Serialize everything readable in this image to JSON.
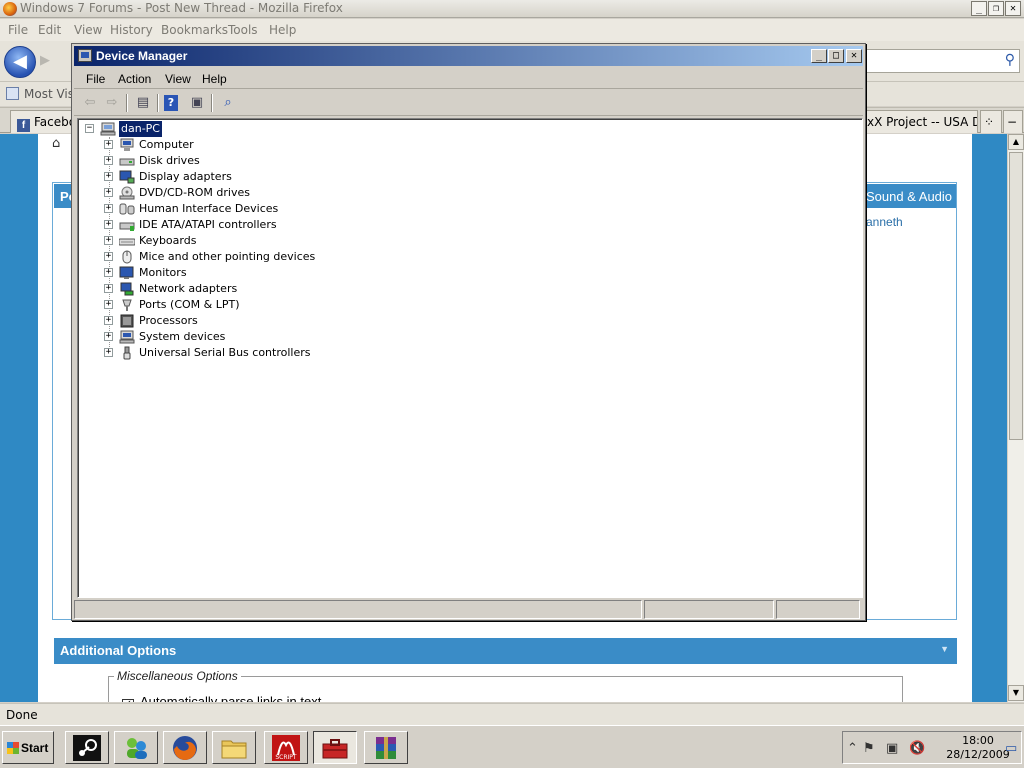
{
  "firefox": {
    "title": "Windows 7 Forums - Post New Thread - Mozilla Firefox",
    "menu": [
      "File",
      "Edit",
      "View",
      "History",
      "Bookmarks",
      "Tools",
      "Help"
    ],
    "bookmarks_label": "Most Visite",
    "tabs": [
      "Facebo",
      "xX Project -- USA Do..."
    ],
    "status": "Done"
  },
  "page": {
    "section_header_left": "Po",
    "section_header_right": "Sound & Audio",
    "user_link": "anneth",
    "additional_options": "Additional Options",
    "misc_options": "Miscellaneous Options",
    "auto_parse": "Automatically parse links in text"
  },
  "device_manager": {
    "title": "Device Manager",
    "menu": [
      "File",
      "Action",
      "View",
      "Help"
    ],
    "root": "dan-PC",
    "categories": [
      {
        "label": "Computer",
        "icon": "computer-icon"
      },
      {
        "label": "Disk drives",
        "icon": "disk-drive-icon"
      },
      {
        "label": "Display adapters",
        "icon": "display-adapter-icon"
      },
      {
        "label": "DVD/CD-ROM drives",
        "icon": "dvd-drive-icon"
      },
      {
        "label": "Human Interface Devices",
        "icon": "hid-icon"
      },
      {
        "label": "IDE ATA/ATAPI controllers",
        "icon": "ide-controller-icon"
      },
      {
        "label": "Keyboards",
        "icon": "keyboard-icon"
      },
      {
        "label": "Mice and other pointing devices",
        "icon": "mouse-icon"
      },
      {
        "label": "Monitors",
        "icon": "monitor-icon"
      },
      {
        "label": "Network adapters",
        "icon": "network-adapter-icon"
      },
      {
        "label": "Ports (COM & LPT)",
        "icon": "port-icon"
      },
      {
        "label": "Processors",
        "icon": "processor-icon"
      },
      {
        "label": "System devices",
        "icon": "system-device-icon"
      },
      {
        "label": "Universal Serial Bus controllers",
        "icon": "usb-icon"
      }
    ]
  },
  "taskbar": {
    "start_label": "Start",
    "apps": [
      "steam",
      "messenger",
      "firefox",
      "explorer",
      "script",
      "toolbox",
      "winrar"
    ],
    "time": "18:00",
    "date": "28/12/2009",
    "active_app": "toolbox"
  }
}
